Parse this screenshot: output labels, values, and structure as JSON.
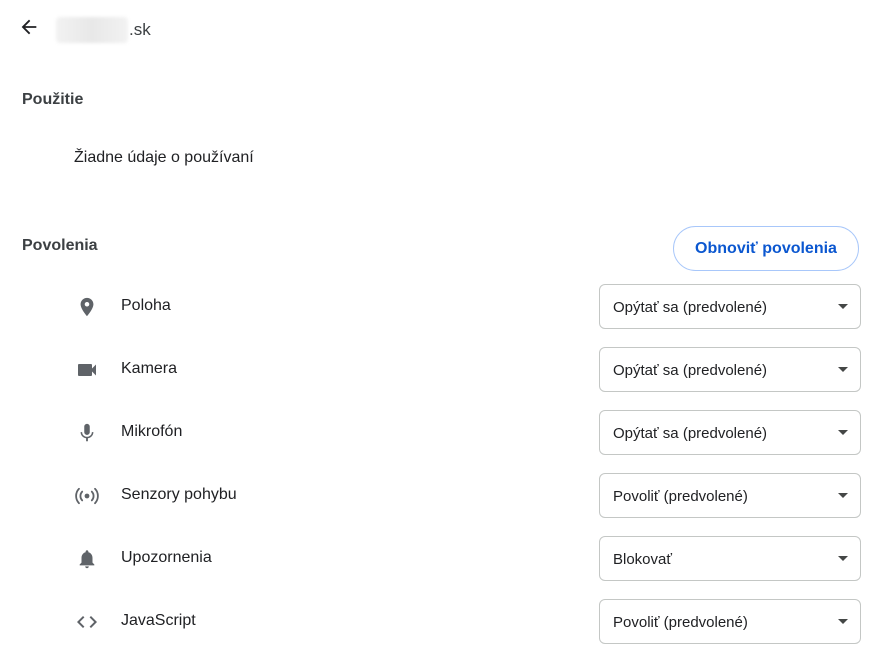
{
  "header": {
    "host_suffix": ".sk"
  },
  "usage": {
    "title": "Použitie",
    "text": "Žiadne údaje o používaní"
  },
  "permissions": {
    "title": "Povolenia",
    "reset_label": "Obnoviť povolenia",
    "items": [
      {
        "label": "Poloha",
        "value": "Opýtať sa (predvolené)",
        "icon": "location-pin-icon"
      },
      {
        "label": "Kamera",
        "value": "Opýtať sa (predvolené)",
        "icon": "camera-icon"
      },
      {
        "label": "Mikrofón",
        "value": "Opýtať sa (predvolené)",
        "icon": "microphone-icon"
      },
      {
        "label": "Senzory pohybu",
        "value": "Povoliť (predvolené)",
        "icon": "motion-sensor-icon"
      },
      {
        "label": "Upozornenia",
        "value": "Blokovať",
        "icon": "bell-icon"
      },
      {
        "label": "JavaScript",
        "value": "Povoliť (predvolené)",
        "icon": "code-icon"
      }
    ]
  },
  "colors": {
    "accent": "#0b57d0",
    "icon": "#5f6368",
    "border": "#c4c7c5"
  }
}
